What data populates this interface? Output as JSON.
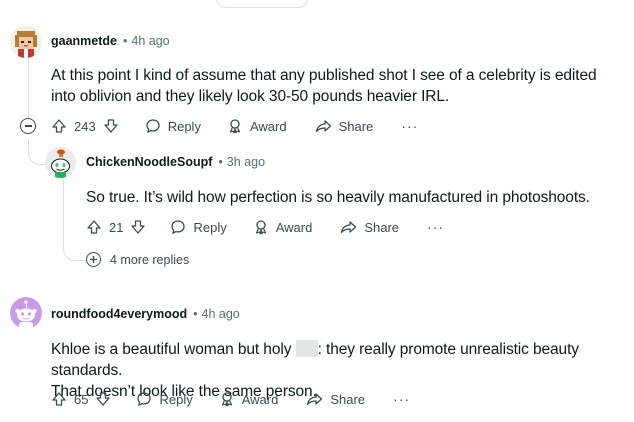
{
  "comments": [
    {
      "username": "gaanmetde",
      "time": "4h ago",
      "body": "At this point I kind of assume that any published shot I see of a celebrity is edited into oblivion and they likely look 30-50 pounds heavier IRL.",
      "votes": "243",
      "reply_label": "Reply",
      "award_label": "Award",
      "share_label": "Share",
      "more_label": "···"
    },
    {
      "username": "ChickenNoodleSoupf",
      "time": "3h ago",
      "body": "So true. It’s wild how perfection is so heavily manufactured in photoshoots.",
      "votes": "21",
      "reply_label": "Reply",
      "award_label": "Award",
      "share_label": "Share",
      "more_label": "···",
      "more_replies": "4 more replies"
    },
    {
      "username": "roundfood4everymood",
      "time": "4h ago",
      "body_before": "Khloe is a beautiful woman but holy",
      "body_after": ": they really promote unrealistic beauty standards.",
      "body_line2": "That doesn’t look like the same person.",
      "votes": "65",
      "reply_label": "Reply",
      "award_label": "Award",
      "share_label": "Share",
      "more_label": "···"
    }
  ],
  "colors": {
    "text": "#0f1a1c",
    "meta": "#576f76",
    "thread_line": "#d9dfe2",
    "icon": "#3c4b50",
    "snoo_purple": "#c99ae8"
  }
}
